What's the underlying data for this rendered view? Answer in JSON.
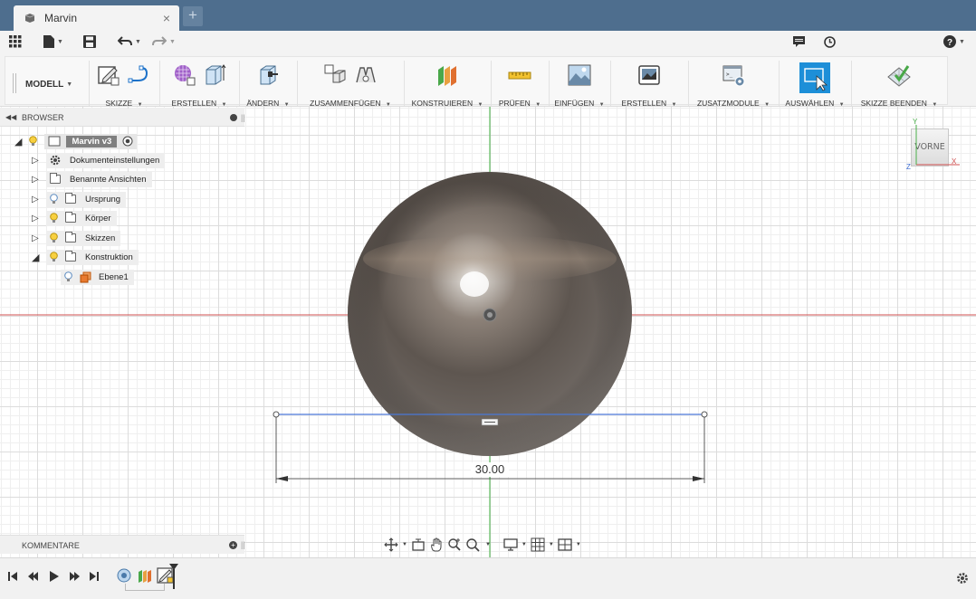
{
  "tab": {
    "title": "Marvin",
    "close_glyph": "×",
    "new_tab_glyph": "+"
  },
  "quick_access": {
    "icons": [
      "apps-grid-icon",
      "file-icon",
      "save-icon",
      "undo-icon",
      "redo-icon",
      "notifications-icon",
      "job-status-icon",
      "help-icon"
    ]
  },
  "ribbon": {
    "workspace_label": "MODELL",
    "groups": [
      {
        "label": "SKIZZE"
      },
      {
        "label": "ERSTELLEN"
      },
      {
        "label": "ÄNDERN"
      },
      {
        "label": "ZUSAMMENFÜGEN"
      },
      {
        "label": "KONSTRUIEREN"
      },
      {
        "label": "PRÜFEN"
      },
      {
        "label": "EINFÜGEN"
      },
      {
        "label": "ERSTELLEN"
      },
      {
        "label": "ZUSATZMODULE"
      },
      {
        "label": "AUSWÄHLEN"
      },
      {
        "label": "SKIZZE BEENDEN"
      }
    ],
    "caret": "▼"
  },
  "browser": {
    "title": "BROWSER",
    "root": "Marvin v3",
    "items": [
      {
        "label": "Dokumenteinstellungen"
      },
      {
        "label": "Benannte Ansichten"
      },
      {
        "label": "Ursprung"
      },
      {
        "label": "Körper"
      },
      {
        "label": "Skizzen"
      },
      {
        "label": "Konstruktion"
      },
      {
        "label": "Ebene1"
      }
    ]
  },
  "comments": {
    "title": "KOMMENTARE"
  },
  "viewcube": {
    "face_label": "VORNE",
    "axes": {
      "x": "X",
      "y": "Y",
      "z": "Z"
    }
  },
  "sketch": {
    "dimension": "30.00"
  },
  "colors": {
    "tabbar": "#4e6e8e",
    "x_axis": "#d05050",
    "y_axis": "#40b040",
    "sketch_line": "#4a78d6",
    "select_blue": "#1d8fd8"
  }
}
